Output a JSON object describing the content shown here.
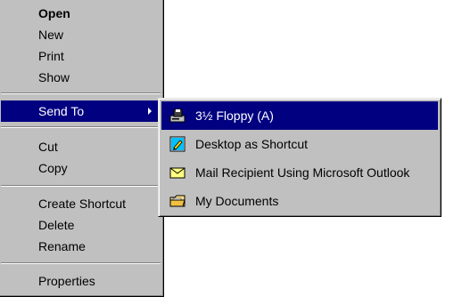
{
  "context_menu": {
    "items": [
      {
        "label": "Open"
      },
      {
        "label": "New"
      },
      {
        "label": "Print"
      },
      {
        "label": "Show"
      },
      {
        "label": "Send To"
      },
      {
        "label": "Cut"
      },
      {
        "label": "Copy"
      },
      {
        "label": "Create Shortcut"
      },
      {
        "label": "Delete"
      },
      {
        "label": "Rename"
      },
      {
        "label": "Properties"
      }
    ]
  },
  "send_to_menu": {
    "items": [
      {
        "label": "3½ Floppy (A)",
        "icon": "floppy-drive-icon"
      },
      {
        "label": "Desktop as Shortcut",
        "icon": "desktop-shortcut-icon"
      },
      {
        "label": "Mail Recipient Using Microsoft Outlook",
        "icon": "envelope-icon"
      },
      {
        "label": "My Documents",
        "icon": "folder-icon"
      }
    ]
  },
  "colors": {
    "menu_face": "#c0c0c0",
    "highlight": "#000080",
    "highlight_text": "#ffffff"
  }
}
